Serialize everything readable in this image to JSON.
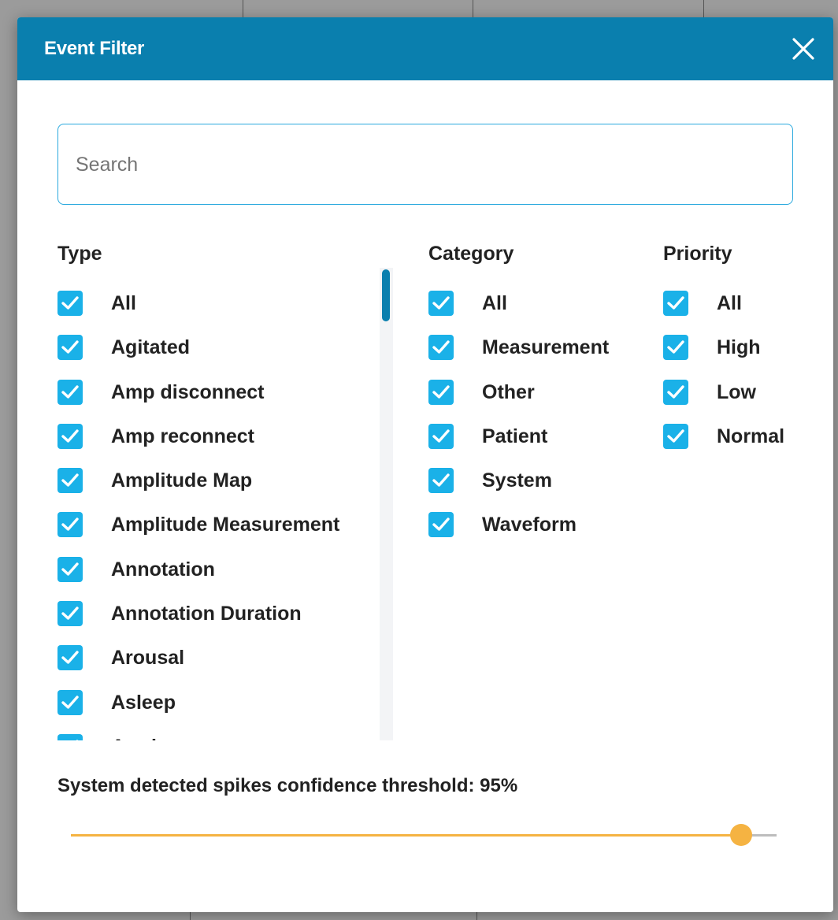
{
  "modal": {
    "title": "Event Filter",
    "close_icon": "close-icon"
  },
  "search": {
    "placeholder": "Search",
    "value": ""
  },
  "type": {
    "title": "Type",
    "items": [
      {
        "label": "All",
        "checked": true
      },
      {
        "label": "Agitated",
        "checked": true
      },
      {
        "label": "Amp disconnect",
        "checked": true
      },
      {
        "label": "Amp reconnect",
        "checked": true
      },
      {
        "label": "Amplitude Map",
        "checked": true
      },
      {
        "label": "Amplitude Measurement",
        "checked": true
      },
      {
        "label": "Annotation",
        "checked": true
      },
      {
        "label": "Annotation Duration",
        "checked": true
      },
      {
        "label": "Arousal",
        "checked": true
      },
      {
        "label": "Asleep",
        "checked": true
      },
      {
        "label": "Awake",
        "checked": true
      }
    ]
  },
  "category": {
    "title": "Category",
    "items": [
      {
        "label": "All",
        "checked": true
      },
      {
        "label": "Measurement",
        "checked": true
      },
      {
        "label": "Other",
        "checked": true
      },
      {
        "label": "Patient",
        "checked": true
      },
      {
        "label": "System",
        "checked": true
      },
      {
        "label": "Waveform",
        "checked": true
      }
    ]
  },
  "priority": {
    "title": "Priority",
    "items": [
      {
        "label": "All",
        "checked": true
      },
      {
        "label": "High",
        "checked": true
      },
      {
        "label": "Low",
        "checked": true
      },
      {
        "label": "Normal",
        "checked": true
      }
    ]
  },
  "threshold": {
    "label": "System detected spikes confidence threshold: 95%",
    "value_percent": 95
  },
  "colors": {
    "header": "#0a7fae",
    "checkbox": "#1ab1e8",
    "slider": "#f5b342",
    "search_border": "#2aa9de"
  }
}
